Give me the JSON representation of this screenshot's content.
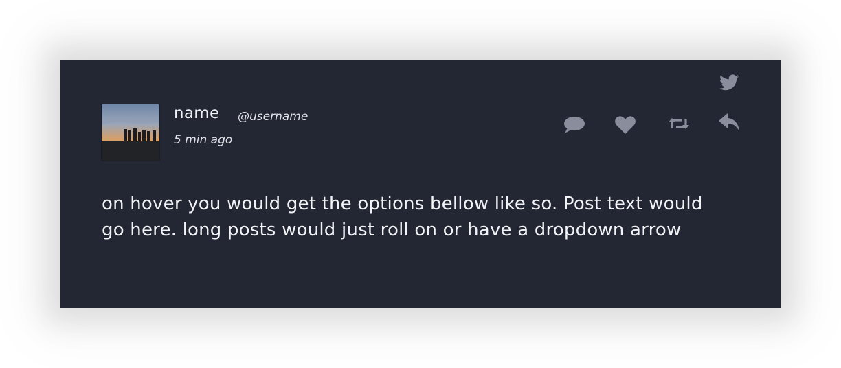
{
  "post": {
    "display_name": "name",
    "username": "@username",
    "timestamp": "5 min ago",
    "text": "on hover you would get the options bellow like so. Post text would go here. long posts would just roll on or have a dropdown arrow",
    "brand_icon": "twitter-bird-icon"
  },
  "actions": [
    {
      "name": "reply-count",
      "icon": "speech-bubble-icon"
    },
    {
      "name": "like",
      "icon": "heart-icon"
    },
    {
      "name": "retweet",
      "icon": "retweet-icon"
    },
    {
      "name": "share",
      "icon": "reply-arrow-icon"
    }
  ],
  "colors": {
    "card_background": "#232633",
    "icon": "#8a8e9c",
    "text": "#f2f3f6"
  }
}
